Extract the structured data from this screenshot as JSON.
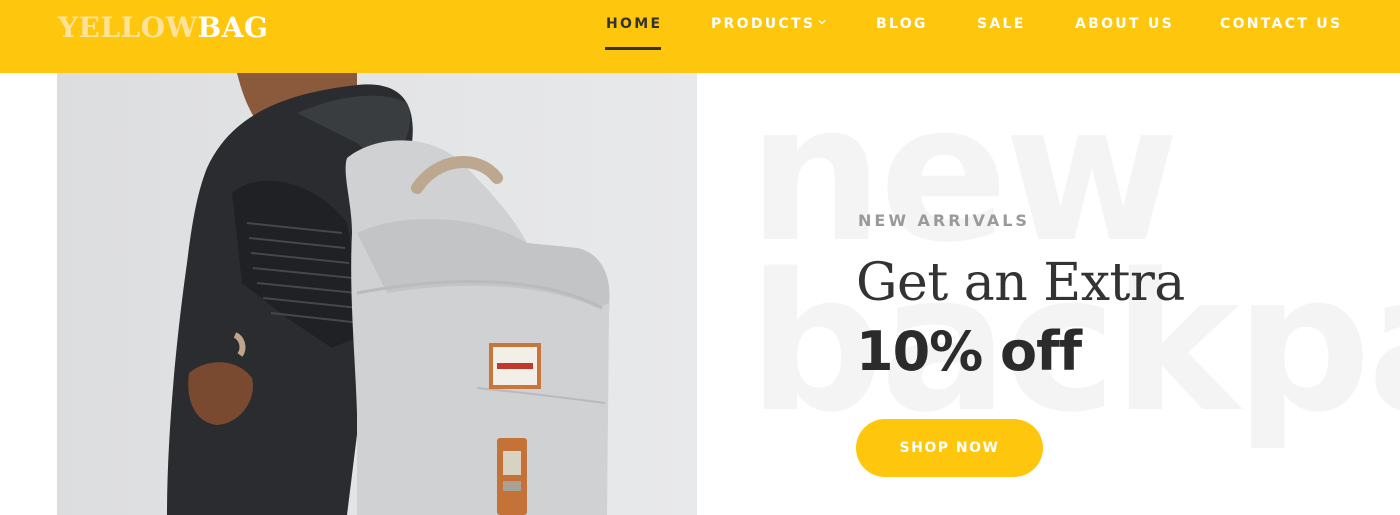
{
  "brand": {
    "logo_part1": "YELLOW",
    "logo_part2": "BAG"
  },
  "nav": {
    "items": [
      {
        "label": "HOME",
        "active": true
      },
      {
        "label": "PRODUCTS",
        "has_dropdown": true
      },
      {
        "label": "BLOG"
      },
      {
        "label": "SALE"
      },
      {
        "label": "ABOUT US"
      },
      {
        "label": "CONTACT US"
      }
    ]
  },
  "hero": {
    "image_icon": "backpack-model-photo",
    "watermark_line1": "new",
    "watermark_line2": "backpa",
    "eyebrow": "NEW ARRIVALS",
    "headline": "Get an Extra",
    "offer": "10% off",
    "cta_label": "SHOP NOW"
  },
  "colors": {
    "accent": "#fec70e",
    "text_dark": "#333333",
    "eyebrow_gray": "#9a9a9a",
    "watermark": "#f4f4f4"
  }
}
